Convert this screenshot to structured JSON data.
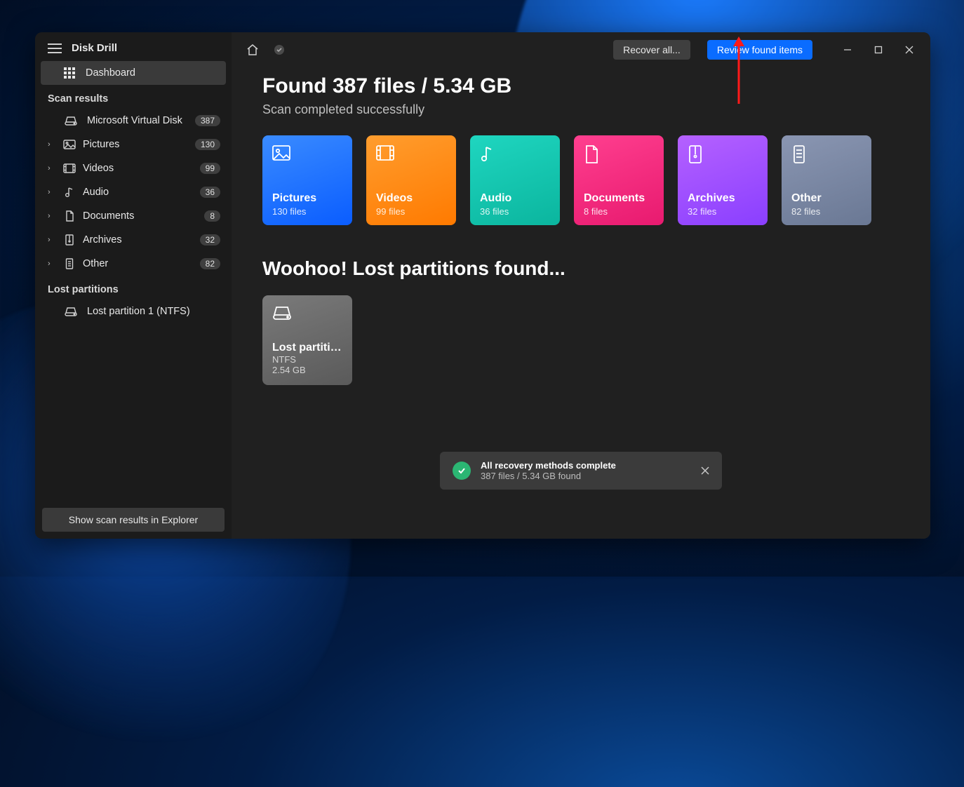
{
  "app": {
    "title": "Disk Drill"
  },
  "sidebar": {
    "dashboard": "Dashboard",
    "section_results": "Scan results",
    "items": [
      {
        "label": "Microsoft Virtual Disk",
        "count": "387"
      },
      {
        "label": "Pictures",
        "count": "130"
      },
      {
        "label": "Videos",
        "count": "99"
      },
      {
        "label": "Audio",
        "count": "36"
      },
      {
        "label": "Documents",
        "count": "8"
      },
      {
        "label": "Archives",
        "count": "32"
      },
      {
        "label": "Other",
        "count": "82"
      }
    ],
    "section_lost": "Lost partitions",
    "lost": [
      {
        "label": "Lost partition 1 (NTFS)"
      }
    ],
    "footer_btn": "Show scan results in Explorer"
  },
  "toolbar": {
    "recover_all": "Recover all...",
    "review": "Review found items"
  },
  "results": {
    "headline": "Found 387 files / 5.34 GB",
    "subhead": "Scan completed successfully",
    "tiles": [
      {
        "title": "Pictures",
        "sub": "130 files"
      },
      {
        "title": "Videos",
        "sub": "99 files"
      },
      {
        "title": "Audio",
        "sub": "36 files"
      },
      {
        "title": "Documents",
        "sub": "8 files"
      },
      {
        "title": "Archives",
        "sub": "32 files"
      },
      {
        "title": "Other",
        "sub": "82 files"
      }
    ],
    "lost_headline": "Woohoo! Lost partitions found...",
    "lost_tile": {
      "title": "Lost partitio…",
      "fs": "NTFS",
      "size": "2.54 GB"
    }
  },
  "toast": {
    "line1": "All recovery methods complete",
    "line2": "387 files / 5.34 GB found"
  }
}
